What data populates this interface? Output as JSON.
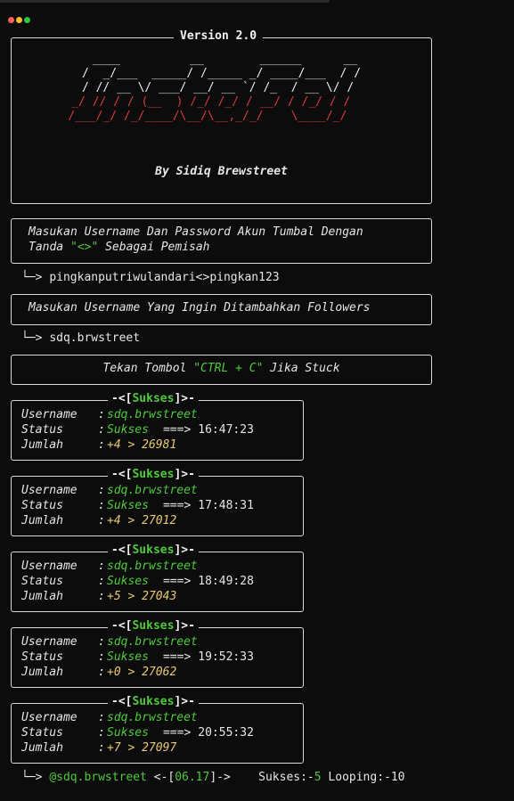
{
  "window": {
    "colors": {
      "close": "#ff5f57",
      "minimize": "#febc2e",
      "maximize": "#28c840"
    }
  },
  "header": {
    "version": "Version 2.0",
    "logo_white": [
      "  ____          __        ______      __ ",
      " /  _/___  _____/ /_____ _/ ____/___  / / ",
      " / // __ \\/ ___/ __/ __ `/ /_  / __ \\/ /  "
    ],
    "logo_red": [
      "_/ // / / (__  ) /_/ /_/ / __/ / /_/ / /   ",
      "/___/_/ /_/____/\\__/\\__,_/_/    \\____/_/    "
    ],
    "author": "By Sidiq Brewstreet"
  },
  "prompt1": {
    "line1": "Masukan Username Dan Password Akun Tumbal Dengan",
    "line2_pre": "Tanda ",
    "line2_hl": "\"<>\"",
    "line2_post": " Sebagai Pemisah",
    "answer": "pingkanputriwulandari<>pingkan123"
  },
  "prompt2": {
    "text": "Masukan Username Yang Ingin Ditambahkan Followers",
    "answer": "sdq.brwstreet"
  },
  "notice": {
    "pre": "Tekan Tombol ",
    "hl": "\"CTRL + C\"",
    "post": " Jika Stuck"
  },
  "arrow": "└─>",
  "labels": {
    "username": "Username",
    "status": "Status",
    "jumlah": "Jumlah",
    "colon": ":",
    "arrow": "===>"
  },
  "results": [
    {
      "title": "Sukses",
      "username": "sdq.brwstreet",
      "status": "Sukses",
      "time": "16:47:23",
      "jumlah": "+4 > 26981"
    },
    {
      "title": "Sukses",
      "username": "sdq.brwstreet",
      "status": "Sukses",
      "time": "17:48:31",
      "jumlah": "+4 > 27012"
    },
    {
      "title": "Sukses",
      "username": "sdq.brwstreet",
      "status": "Sukses",
      "time": "18:49:28",
      "jumlah": "+5 > 27043"
    },
    {
      "title": "Sukses",
      "username": "sdq.brwstreet",
      "status": "Sukses",
      "time": "19:52:33",
      "jumlah": "+0 > 27062"
    },
    {
      "title": "Sukses",
      "username": "sdq.brwstreet",
      "status": "Sukses",
      "time": "20:55:32",
      "jumlah": "+7 > 27097"
    }
  ],
  "footer": {
    "user": "@sdq.brwstreet",
    "mid_pre": " <-[",
    "timer": "06.17",
    "mid_post": "]->",
    "sukses_label": "Sukses:-",
    "sukses_count": "5",
    "looping": " Looping:-10"
  }
}
